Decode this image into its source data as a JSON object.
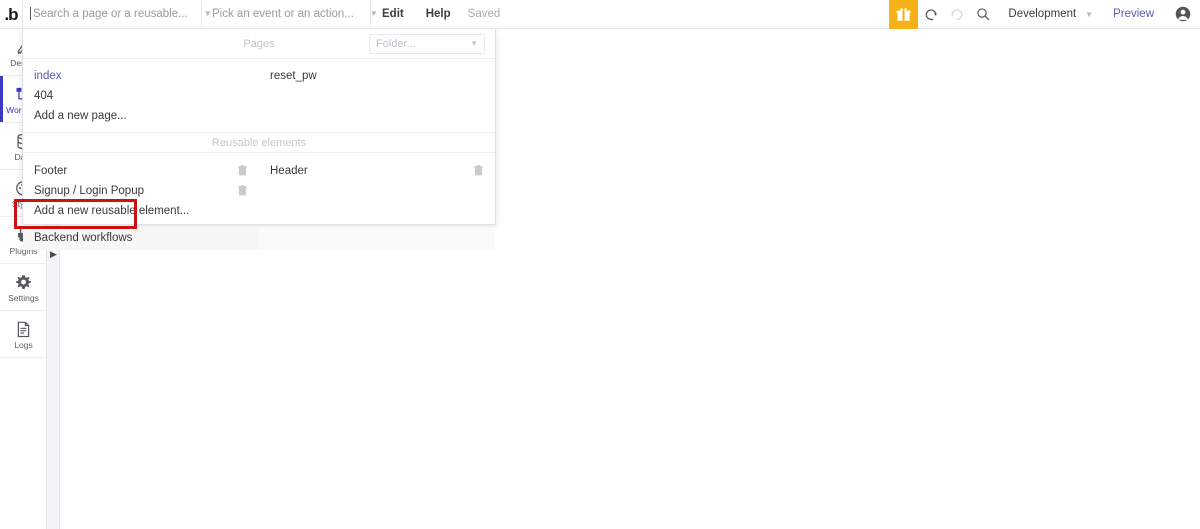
{
  "app": {
    "logo_text": ".b",
    "accent_orange": "#f5b117",
    "accent_indigo": "#3a3ac4",
    "link_purple": "#5a5ab5",
    "highlight_red": "#cc1111"
  },
  "toolbar": {
    "search_placeholder": "Search a page or a reusable...",
    "event_placeholder": "Pick an event or an action...",
    "edit_label": "Edit",
    "help_label": "Help",
    "save_status": "Saved",
    "gift_icon": "gift-icon",
    "undo_icon": "undo-icon",
    "redo_icon": "redo-icon",
    "search_icon": "search-icon",
    "environment_label": "Development",
    "preview_label": "Preview",
    "avatar_icon": "user-avatar-icon",
    "caret_glyph": "▼"
  },
  "sidebar": {
    "items": [
      {
        "label": "Design",
        "icon": "design-icon",
        "active": false
      },
      {
        "label": "Workflow",
        "icon": "workflow-icon",
        "active": true
      },
      {
        "label": "Data",
        "icon": "data-icon",
        "active": false
      },
      {
        "label": "Styles",
        "icon": "styles-icon",
        "active": false
      },
      {
        "label": "Plugins",
        "icon": "plugins-icon",
        "active": false
      },
      {
        "label": "Settings",
        "icon": "gear-icon",
        "active": false
      },
      {
        "label": "Logs",
        "icon": "logs-icon",
        "active": false
      }
    ],
    "flyout_arrow": "▶"
  },
  "panel": {
    "pages_section_title": "Pages",
    "folder_placeholder": "Folder...",
    "folder_caret": "▼",
    "reusable_section_title": "Reusable elements",
    "pages": [
      {
        "left": "index",
        "left_is_link": true,
        "right": "reset_pw",
        "right_is_link": false
      },
      {
        "left": "404",
        "left_is_link": false,
        "right": "",
        "right_is_link": false
      },
      {
        "left": "Add a new page...",
        "left_is_link": false,
        "right": "",
        "right_is_link": false
      }
    ],
    "reusables": [
      {
        "left": "Footer",
        "left_trash": true,
        "right": "Header",
        "right_trash": true
      },
      {
        "left": "Signup / Login Popup",
        "left_trash": true,
        "right": "",
        "right_trash": false
      },
      {
        "left": "Add a new reusable element...",
        "left_trash": false,
        "right": "",
        "right_trash": false
      }
    ],
    "backend_workflows_label": "Backend workflows",
    "trash_icon": "trash-icon"
  },
  "annotation": {
    "target": "Backend workflows",
    "shape": "rectangle-outline",
    "color": "#cc1111"
  }
}
